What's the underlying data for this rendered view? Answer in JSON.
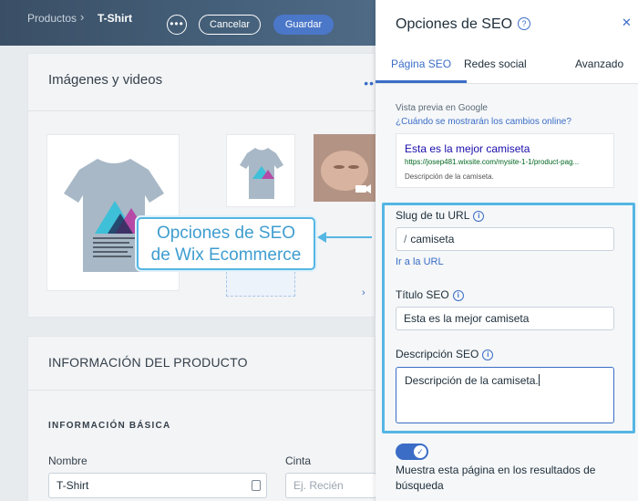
{
  "header": {
    "breadcrumb_root": "Productos",
    "breadcrumb_sep": "›",
    "breadcrumb_current": "T-Shirt",
    "more_label": "•••",
    "cancel_label": "Cancelar",
    "save_label": "Guardar"
  },
  "media": {
    "title": "Imágenes y videos",
    "more_label": "••",
    "next_label": "›"
  },
  "product_info": {
    "title": "INFORMACIÓN DEL PRODUCTO",
    "subtitle": "INFORMACIÓN BÁSICA",
    "name_label": "Nombre",
    "name_value": "T-Shirt",
    "ribbon_label": "Cinta",
    "ribbon_placeholder": "Ej. Recién llegado"
  },
  "callout": {
    "line1": "Opciones de SEO",
    "line2": "de Wix Ecommerce"
  },
  "seo_panel": {
    "title": "Opciones de SEO",
    "help": "?",
    "close": "✕",
    "tabs": [
      {
        "label": "Página SEO"
      },
      {
        "label": "Redes social"
      },
      {
        "label": "Avanzado"
      }
    ],
    "preview_label": "Vista previa en Google",
    "preview_link": "¿Cuándo se mostrarán los cambios online?",
    "google": {
      "title": "Esta es la mejor camiseta",
      "url": "https://josep481.wixsite.com/mysite-1-1/product-pag...",
      "desc": "Descripción de la camiseta."
    },
    "slug_label": "Slug de tu URL",
    "slug_prefix": "/",
    "slug_value": "camiseta",
    "url_link": "Ir a la URL",
    "seo_title_label": "Título SEO",
    "seo_title_value": "Esta es la mejor camiseta",
    "seo_desc_label": "Descripción SEO",
    "seo_desc_value": "Descripción de la camiseta.",
    "info": "i",
    "toggle_check": "✓",
    "toggle_on": true,
    "toggle_text": "Muestra esta página en los resultados de búsqueda"
  },
  "colors": {
    "accent": "#3b6dc6",
    "callout": "#55b6e3",
    "header_bg": "#45607a"
  }
}
